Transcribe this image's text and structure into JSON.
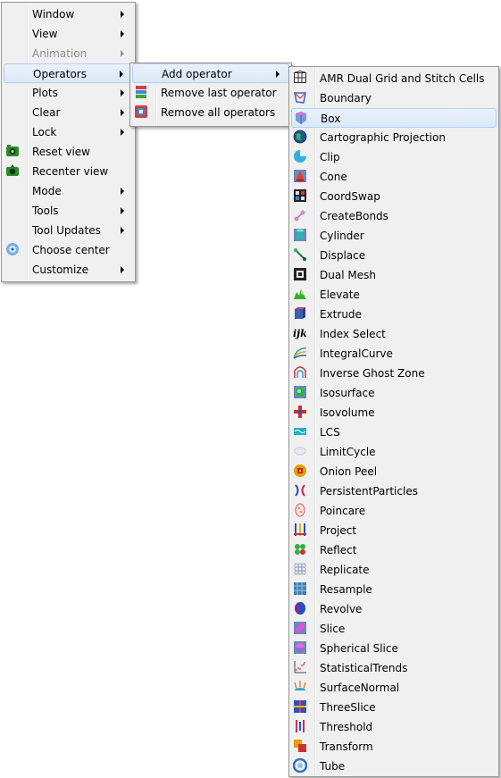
{
  "main_menu": {
    "items": [
      {
        "label": "Window",
        "submenu": true
      },
      {
        "label": "View",
        "submenu": true
      },
      {
        "label": "Animation",
        "submenu": true,
        "disabled": true
      },
      {
        "label": "Operators",
        "submenu": true,
        "highlighted": true
      },
      {
        "label": "Plots",
        "submenu": true
      },
      {
        "label": "Clear",
        "submenu": true
      },
      {
        "label": "Lock",
        "submenu": true
      },
      {
        "label": "Reset view",
        "icon": "reset-view-icon"
      },
      {
        "label": "Recenter view",
        "icon": "recenter-view-icon"
      },
      {
        "label": "Mode",
        "submenu": true
      },
      {
        "label": "Tools",
        "submenu": true
      },
      {
        "label": "Tool Updates",
        "submenu": true
      },
      {
        "label": "Choose center",
        "icon": "choose-center-icon"
      },
      {
        "label": "Customize",
        "submenu": true
      }
    ]
  },
  "operators_menu": {
    "items": [
      {
        "label": "Add operator",
        "submenu": true,
        "highlighted": true
      },
      {
        "label": "Remove last operator",
        "icon": "remove-last-operator-icon"
      },
      {
        "label": "Remove all operators",
        "icon": "remove-all-operators-icon"
      }
    ]
  },
  "add_operator_menu": {
    "highlighted": "Box",
    "items": [
      {
        "label": "AMR Dual Grid and Stitch Cells",
        "icon": "amr-grid-icon",
        "color": "#555555"
      },
      {
        "label": "Boundary",
        "icon": "boundary-icon",
        "color": "#3a5fd0"
      },
      {
        "label": "Box",
        "icon": "box-icon",
        "color": "#c040c0"
      },
      {
        "label": "Cartographic Projection",
        "icon": "globe-icon",
        "color": "#1a6a9a"
      },
      {
        "label": "Clip",
        "icon": "clip-icon",
        "color": "#20a0d0"
      },
      {
        "label": "Cone",
        "icon": "cone-icon",
        "color": "#d03030"
      },
      {
        "label": "CoordSwap",
        "icon": "coordswap-icon",
        "color": "#333333"
      },
      {
        "label": "CreateBonds",
        "icon": "create-bonds-icon",
        "color": "#b070c0"
      },
      {
        "label": "Cylinder",
        "icon": "cylinder-icon",
        "color": "#30a0a0"
      },
      {
        "label": "Displace",
        "icon": "displace-icon",
        "color": "#208040"
      },
      {
        "label": "Dual Mesh",
        "icon": "dual-mesh-icon",
        "color": "#202020"
      },
      {
        "label": "Elevate",
        "icon": "elevate-icon",
        "color": "#30b030"
      },
      {
        "label": "Extrude",
        "icon": "extrude-icon",
        "color": "#b03070"
      },
      {
        "label": "Index Select",
        "icon": "index-select-icon",
        "color": "#000000"
      },
      {
        "label": "IntegralCurve",
        "icon": "integral-curve-icon",
        "color": "#30a090"
      },
      {
        "label": "Inverse Ghost Zone",
        "icon": "inverse-ghost-zone-icon",
        "color": "#c03030"
      },
      {
        "label": "Isosurface",
        "icon": "isosurface-icon",
        "color": "#2070b0"
      },
      {
        "label": "Isovolume",
        "icon": "isovolume-icon",
        "color": "#d03020"
      },
      {
        "label": "LCS",
        "icon": "lcs-icon",
        "color": "#20b0c0"
      },
      {
        "label": "LimitCycle",
        "icon": "limit-cycle-icon",
        "color": "#d8d8e8"
      },
      {
        "label": "Onion Peel",
        "icon": "onion-peel-icon",
        "color": "#c08000"
      },
      {
        "label": "PersistentParticles",
        "icon": "persistent-particles-icon",
        "color": "#b02060"
      },
      {
        "label": "Poincare",
        "icon": "poincare-icon",
        "color": "#d06060"
      },
      {
        "label": "Project",
        "icon": "project-icon",
        "color": "#2050c0"
      },
      {
        "label": "Reflect",
        "icon": "reflect-icon",
        "color": "#30b040"
      },
      {
        "label": "Replicate",
        "icon": "replicate-icon",
        "color": "#90a0c0"
      },
      {
        "label": "Resample",
        "icon": "resample-icon",
        "color": "#4080b0"
      },
      {
        "label": "Revolve",
        "icon": "revolve-icon",
        "color": "#7030a0"
      },
      {
        "label": "Slice",
        "icon": "slice-icon",
        "color": "#c040c0"
      },
      {
        "label": "Spherical Slice",
        "icon": "spherical-slice-icon",
        "color": "#8040c0"
      },
      {
        "label": "StatisticalTrends",
        "icon": "statistical-trends-icon",
        "color": "#c03030"
      },
      {
        "label": "SurfaceNormal",
        "icon": "surface-normal-icon",
        "color": "#c07030"
      },
      {
        "label": "ThreeSlice",
        "icon": "three-slice-icon",
        "color": "#3050c0"
      },
      {
        "label": "Threshold",
        "icon": "threshold-icon",
        "color": "#c03060"
      },
      {
        "label": "Transform",
        "icon": "transform-icon",
        "color": "#e0a000"
      },
      {
        "label": "Tube",
        "icon": "tube-icon",
        "color": "#3070c0"
      }
    ]
  }
}
